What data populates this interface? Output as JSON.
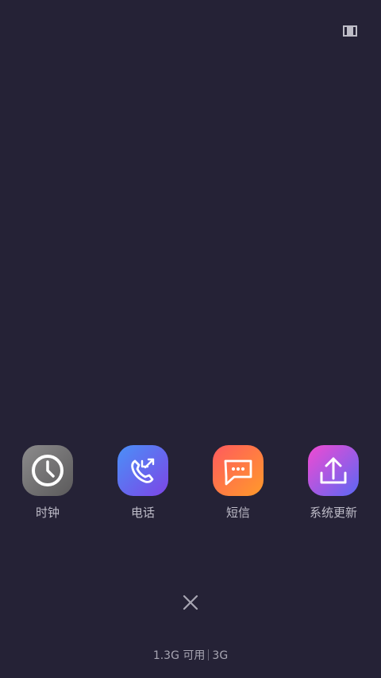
{
  "top_right_icon": "multi-window-icon",
  "apps": [
    {
      "label": "时钟",
      "icon": "clock-icon"
    },
    {
      "label": "电话",
      "icon": "phone-icon"
    },
    {
      "label": "短信",
      "icon": "message-icon"
    },
    {
      "label": "系统更新",
      "icon": "system-update-icon"
    }
  ],
  "footer": {
    "memory_left": "1.3G 可用",
    "memory_right": "3G"
  },
  "colors": {
    "background": "#252236",
    "label": "#BEBCC8",
    "clock_gradient": [
      "#848384",
      "#5E5D5E"
    ],
    "phone_gradient": [
      "#4C8AF5",
      "#7A49E7"
    ],
    "message_gradient": [
      "#FF5F58",
      "#FF8E2E"
    ],
    "update_gradient": [
      "#F54BCE",
      "#5B6BF3"
    ]
  }
}
